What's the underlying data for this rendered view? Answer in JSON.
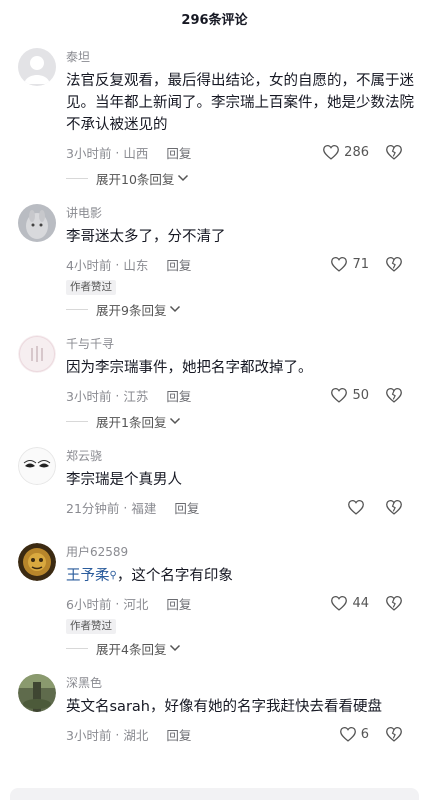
{
  "header": {
    "title": "296条评论"
  },
  "comments": [
    {
      "username": "泰坦",
      "content": "法官反复观看，最后得出结论，女的自愿的，不属于迷见。当年都上新闻了。李宗瑞上百案件，她是少数法院不承认被迷见的",
      "time": "3小时前",
      "location": "山西",
      "reply_label": "回复",
      "likes": "286",
      "expand": "展开10条回复"
    },
    {
      "username": "讲电影",
      "content": "李哥迷太多了，分不清了",
      "time": "4小时前",
      "location": "山东",
      "reply_label": "回复",
      "likes": "71",
      "badge": "作者赞过",
      "expand": "展开9条回复"
    },
    {
      "username": "千与千寻",
      "content": "因为李宗瑞事件，她把名字都改掉了。",
      "time": "3小时前",
      "location": "江苏",
      "reply_label": "回复",
      "likes": "50",
      "expand": "展开1条回复"
    },
    {
      "username": "郑云骁",
      "content": "李宗瑞是个真男人",
      "time": "21分钟前",
      "location": "福建",
      "reply_label": "回复",
      "likes": ""
    },
    {
      "username": "用户62589",
      "mention": "王予柔",
      "content_after_mention": "，这个名字有印象",
      "time": "6小时前",
      "location": "河北",
      "reply_label": "回复",
      "likes": "44",
      "badge": "作者赞过",
      "expand": "展开4条回复"
    },
    {
      "username": "深黑色",
      "content": "英文名sarah，好像有她的名字我赶快去看看硬盘",
      "time": "3小时前",
      "location": "湖北",
      "reply_label": "回复",
      "likes": "6"
    }
  ],
  "icons": {
    "like": "heart-outline-icon",
    "dislike": "broken-heart-icon",
    "expand": "chevron-down-icon",
    "mention": "search-icon"
  }
}
